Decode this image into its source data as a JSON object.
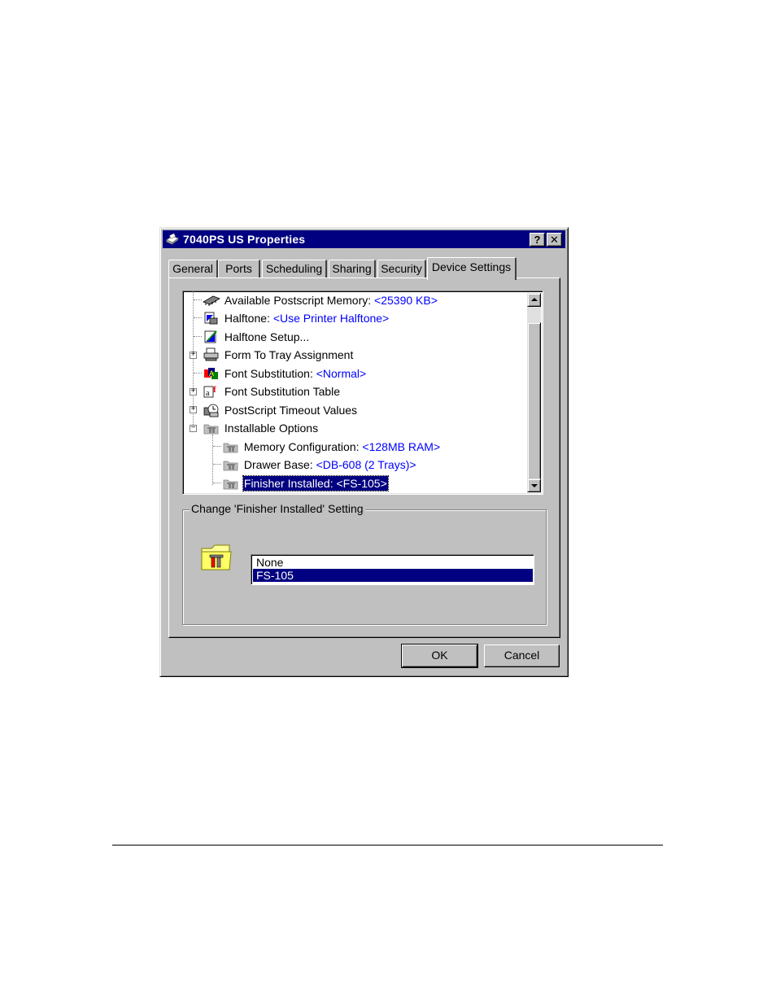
{
  "window": {
    "title": "7040PS US Properties",
    "help_button": "?",
    "close_button": "✕"
  },
  "tabs": [
    {
      "label": "General"
    },
    {
      "label": "Ports"
    },
    {
      "label": "Scheduling"
    },
    {
      "label": "Sharing"
    },
    {
      "label": "Security"
    },
    {
      "label": "Device Settings",
      "active": true
    }
  ],
  "tree": {
    "items": [
      {
        "label": "Available Postscript Memory:",
        "value": "<25390 KB>",
        "icon": "memory-chip-icon"
      },
      {
        "label": "Halftone:",
        "value": "<Use Printer Halftone>",
        "icon": "halftone-icon"
      },
      {
        "label": "Halftone Setup...",
        "value": "",
        "icon": "halftone-setup-icon"
      },
      {
        "label": "Form To Tray Assignment",
        "value": "",
        "icon": "printer-tray-icon",
        "expandable": "+"
      },
      {
        "label": "Font Substitution:",
        "value": "<Normal>",
        "icon": "font-substitution-icon"
      },
      {
        "label": "Font Substitution Table",
        "value": "",
        "icon": "font-table-icon",
        "expandable": "+"
      },
      {
        "label": "PostScript Timeout Values",
        "value": "",
        "icon": "timeout-icon",
        "expandable": "+"
      },
      {
        "label": "Installable Options",
        "value": "",
        "icon": "options-folder-icon",
        "expandable": "−"
      },
      {
        "label": "Memory Configuration:",
        "value": "<128MB RAM>",
        "icon": "options-folder-icon"
      },
      {
        "label": "Drawer Base:",
        "value": "<DB-608 (2 Trays)>",
        "icon": "options-folder-icon"
      },
      {
        "label": "Finisher Installed:",
        "value": "<FS-105>",
        "icon": "options-folder-icon",
        "selected": true
      }
    ]
  },
  "setting_group": {
    "label": "Change 'Finisher Installed' Setting",
    "options": [
      "None",
      "FS-105"
    ],
    "selected": "FS-105"
  },
  "buttons": {
    "ok": "OK",
    "cancel": "Cancel"
  },
  "colors": {
    "title_bar": "#000080",
    "value_text": "#0000ff",
    "selection": "#000080",
    "face": "#c0c0c0"
  }
}
